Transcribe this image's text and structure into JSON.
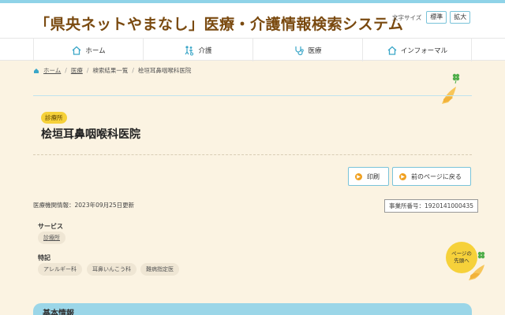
{
  "header": {
    "site_title": "「県央ネットやまなし」医療・介護情報検索システム",
    "font_size_label": "文字サイズ",
    "font_size_standard": "標準",
    "font_size_large": "拡大"
  },
  "nav": [
    {
      "label": "ホーム",
      "icon": "home-icon"
    },
    {
      "label": "介護",
      "icon": "care-icon"
    },
    {
      "label": "医療",
      "icon": "medical-icon"
    },
    {
      "label": "インフォーマル",
      "icon": "informal-icon"
    }
  ],
  "breadcrumb": {
    "home": "ホーム",
    "medical": "医療",
    "results": "検索結果一覧",
    "current": "桧垣耳鼻咽喉科医院"
  },
  "clinic": {
    "category": "診療所",
    "name": "桧垣耳鼻咽喉科医院",
    "updated": "医療機関情報：2023年09月25日更新",
    "office_number": "事業所番号：1920141000435"
  },
  "actions": {
    "print": "印刷",
    "back": "前のページに戻る"
  },
  "service": {
    "label": "サービス",
    "chips": [
      "診療所"
    ]
  },
  "features": {
    "label": "特記",
    "chips": [
      "アレルギー科",
      "耳鼻いんこう科",
      "難病指定医"
    ]
  },
  "back_to_top": {
    "line1": "ページの",
    "line2": "先頭へ"
  },
  "basic_info": {
    "title": "基本情報"
  },
  "colors": {
    "accent": "#9bd6e8",
    "brand_brown": "#7a4a10",
    "yellow": "#f6d13a"
  }
}
